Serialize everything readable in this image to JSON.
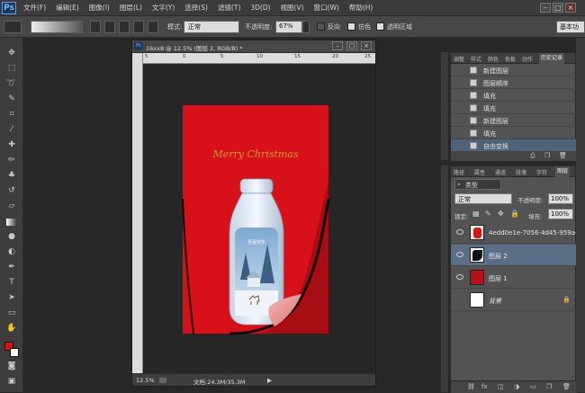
{
  "menu": [
    "文件(F)",
    "编辑(E)",
    "图像(I)",
    "图层(L)",
    "文字(Y)",
    "选择(S)",
    "滤镜(T)",
    "3D(D)",
    "视图(V)",
    "窗口(W)",
    "帮助(H)"
  ],
  "app_logo": "Ps",
  "options": {
    "mode_label": "模式:",
    "mode_value": "正常",
    "opacity_label": "不透明度:",
    "opacity_value": "67%",
    "reverse_label": "反向",
    "dither_label": "仿色",
    "transparency_label": "透明区域",
    "workspace_label": "基本功"
  },
  "document": {
    "title": "16xx8 @ 12.5% (图层 2, RGB/8) *",
    "ruler_marks": [
      "5",
      "0",
      "5",
      "10",
      "15",
      "20",
      "25"
    ],
    "zoom": "12.5%",
    "doc_info": "文档:24.3M/35.3M"
  },
  "artwork": {
    "greeting": "Merry Christmas",
    "label_text": "圣诞快乐",
    "background_color": "#d8101a",
    "accent_color": "#c8a030"
  },
  "history": {
    "tabs": [
      "调整",
      "样式",
      "颜色",
      "色板",
      "动作",
      "历史记录"
    ],
    "active_tab": "历史记录",
    "items": [
      {
        "label": "新建图层"
      },
      {
        "label": "图层顺序"
      },
      {
        "label": "填充"
      },
      {
        "label": "填充"
      },
      {
        "label": "新建图层"
      },
      {
        "label": "填充"
      },
      {
        "label": "自由变换"
      }
    ],
    "selected_index": 6
  },
  "layers": {
    "tabs": [
      "路径",
      "属性",
      "通道",
      "段落",
      "字符",
      "图层"
    ],
    "active_tab": "图层",
    "filter_label": "类型",
    "blend_mode": "正常",
    "opacity_label": "不透明度:",
    "opacity_value": "100%",
    "lock_label": "锁定:",
    "fill_label": "填充:",
    "fill_value": "100%",
    "items": [
      {
        "name": "4edd0e1e-7056-4d45-959a-..."
      },
      {
        "name": "图层 2"
      },
      {
        "name": "图层 1"
      },
      {
        "name": "背景"
      }
    ],
    "selected_index": 1
  },
  "colors": {
    "foreground": "#e01010",
    "background": "#ffffff"
  }
}
